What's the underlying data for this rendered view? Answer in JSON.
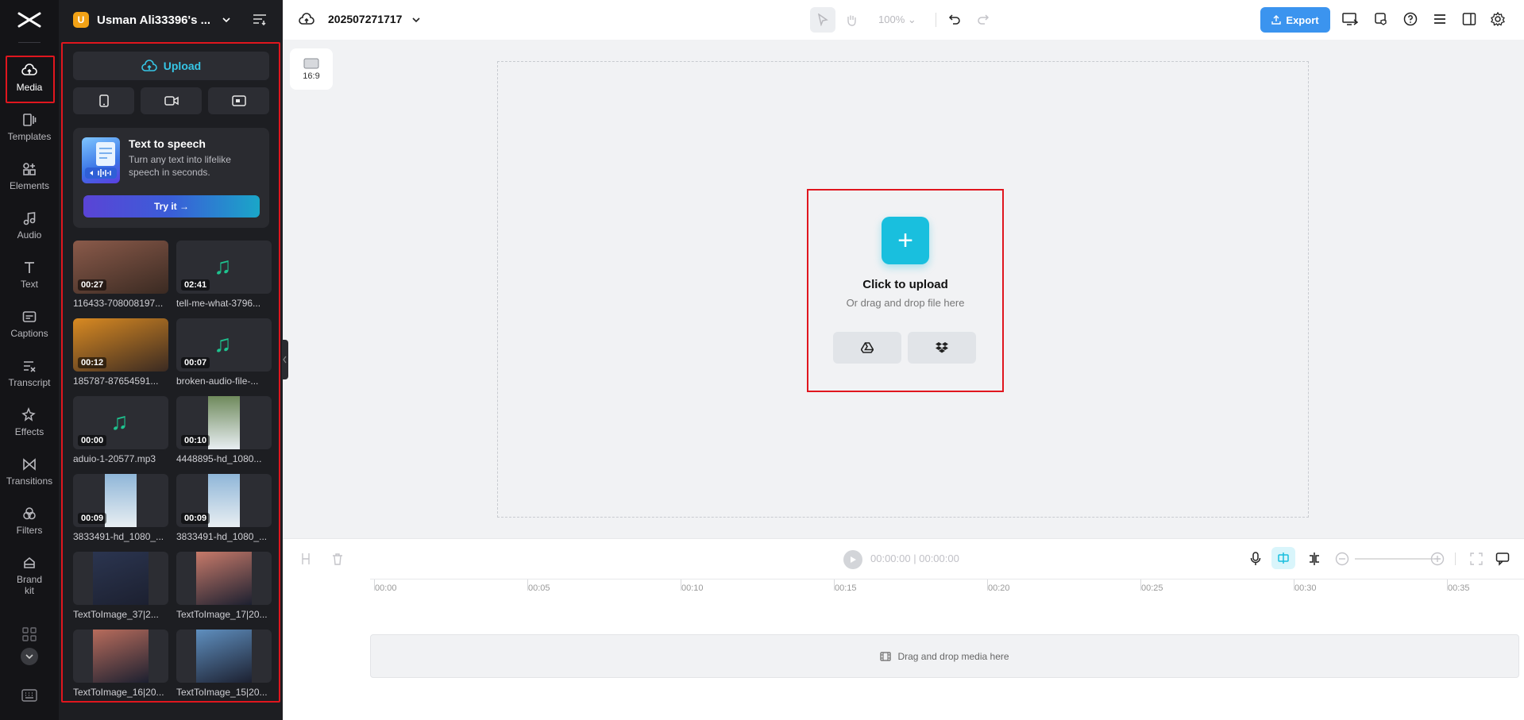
{
  "rail": {
    "items": [
      {
        "label": "Media",
        "icon": "cloud-upload-icon"
      },
      {
        "label": "Templates",
        "icon": "template-icon"
      },
      {
        "label": "Elements",
        "icon": "elements-icon"
      },
      {
        "label": "Audio",
        "icon": "music-note-icon"
      },
      {
        "label": "Text",
        "icon": "text-icon"
      },
      {
        "label": "Captions",
        "icon": "captions-icon"
      },
      {
        "label": "Transcript",
        "icon": "transcript-icon"
      },
      {
        "label": "Effects",
        "icon": "effects-icon"
      },
      {
        "label": "Transitions",
        "icon": "transitions-icon"
      },
      {
        "label": "Filters",
        "icon": "filters-icon"
      },
      {
        "label": "Brand kit",
        "icon": "brand-kit-icon"
      }
    ]
  },
  "panel": {
    "workspace_initial": "U",
    "workspace_name": "Usman Ali33396's ...",
    "upload_label": "Upload",
    "tts": {
      "title": "Text to speech",
      "description": "Turn any text into lifelike speech in seconds.",
      "button": "Try it →"
    },
    "media": [
      {
        "name": "116433-708008197...",
        "duration": "00:27",
        "kind": "video",
        "thumb": "#8a5a4a"
      },
      {
        "name": "tell-me-what-3796...",
        "duration": "02:41",
        "kind": "audio"
      },
      {
        "name": "185787-87654591...",
        "duration": "00:12",
        "kind": "video",
        "thumb": "#d98a22"
      },
      {
        "name": "broken-audio-file-...",
        "duration": "00:07",
        "kind": "audio"
      },
      {
        "name": "aduio-1-20577.mp3",
        "duration": "00:00",
        "kind": "audio"
      },
      {
        "name": "4448895-hd_1080...",
        "duration": "00:10",
        "kind": "video-portrait",
        "thumb": "#6f8a5c"
      },
      {
        "name": "3833491-hd_1080_...",
        "duration": "00:09",
        "kind": "video-portrait",
        "thumb": "#8fb6d8"
      },
      {
        "name": "3833491-hd_1080_...",
        "duration": "00:09",
        "kind": "video-portrait",
        "thumb": "#8fb6d8"
      },
      {
        "name": "TextToImage_37|2...",
        "duration": "",
        "kind": "image",
        "thumb": "#2b3550"
      },
      {
        "name": "TextToImage_17|20...",
        "duration": "",
        "kind": "image",
        "thumb": "#c77a6a"
      },
      {
        "name": "TextToImage_16|20...",
        "duration": "",
        "kind": "image",
        "thumb": "#b86c5c"
      },
      {
        "name": "TextToImage_15|20...",
        "duration": "",
        "kind": "image",
        "thumb": "#5f8fbf"
      }
    ]
  },
  "topbar": {
    "project_name": "202507271717",
    "zoom": "100%",
    "export_label": "Export"
  },
  "canvas": {
    "ratio": "16:9",
    "upload_title": "Click to upload",
    "upload_hint": "Or drag and drop file here"
  },
  "timeline": {
    "current": "00:00:00",
    "total": "00:00:00",
    "ticks": [
      "00:00",
      "00:05",
      "00:10",
      "00:15",
      "00:20",
      "00:25",
      "00:30",
      "00:35"
    ],
    "track_hint": "Drag and drop media here"
  },
  "colors": {
    "accent": "#19bfde",
    "export": "#3b94ef",
    "highlight": "#e0161e",
    "audio_note": "#1ec38f"
  }
}
